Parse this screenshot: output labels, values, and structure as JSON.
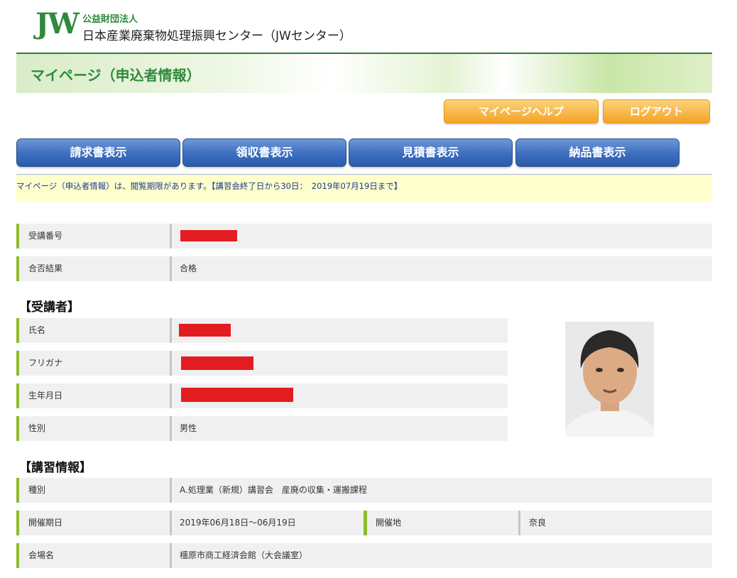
{
  "header": {
    "logo": "JW",
    "org_type": "公益財団法人",
    "org_name": "日本産業廃棄物処理振興センター（JWセンター）"
  },
  "banner": {
    "title": "マイページ（申込者情報）"
  },
  "top_buttons": {
    "help": "マイページヘルプ",
    "logout": "ログアウト"
  },
  "doc_buttons": [
    "請求書表示",
    "領収書表示",
    "見積書表示",
    "納品書表示"
  ],
  "notice": "マイページ（申込者情報）は、閲覧期限があります。【講習会終了日から30日：　2019年07月19日まで】",
  "summary": {
    "exam_number_label": "受講番号",
    "result_label": "合否結果",
    "result_value": "合格"
  },
  "attendee": {
    "section_title": "【受講者】",
    "name_label": "氏名",
    "kana_label": "フリガナ",
    "birth_label": "生年月日",
    "gender_label": "性別",
    "gender_value": "男性"
  },
  "course": {
    "section_title": "【講習情報】",
    "type_label": "種別",
    "type_value": "A.処理業（新規）講習会　産廃の収集・運搬課程",
    "date_label": "開催期日",
    "date_value": "2019年06月18日～06月19日",
    "place_label": "開催地",
    "place_value": "奈良",
    "venue_label": "会場名",
    "venue_value": "橿原市商工経済会館（大会議室）"
  },
  "colors": {
    "accent_green": "#8fbb2e",
    "title_green": "#2e8b3c",
    "button_blue": "#3c6ec0",
    "button_orange": "#f3a325",
    "redaction": "#e31c22"
  }
}
